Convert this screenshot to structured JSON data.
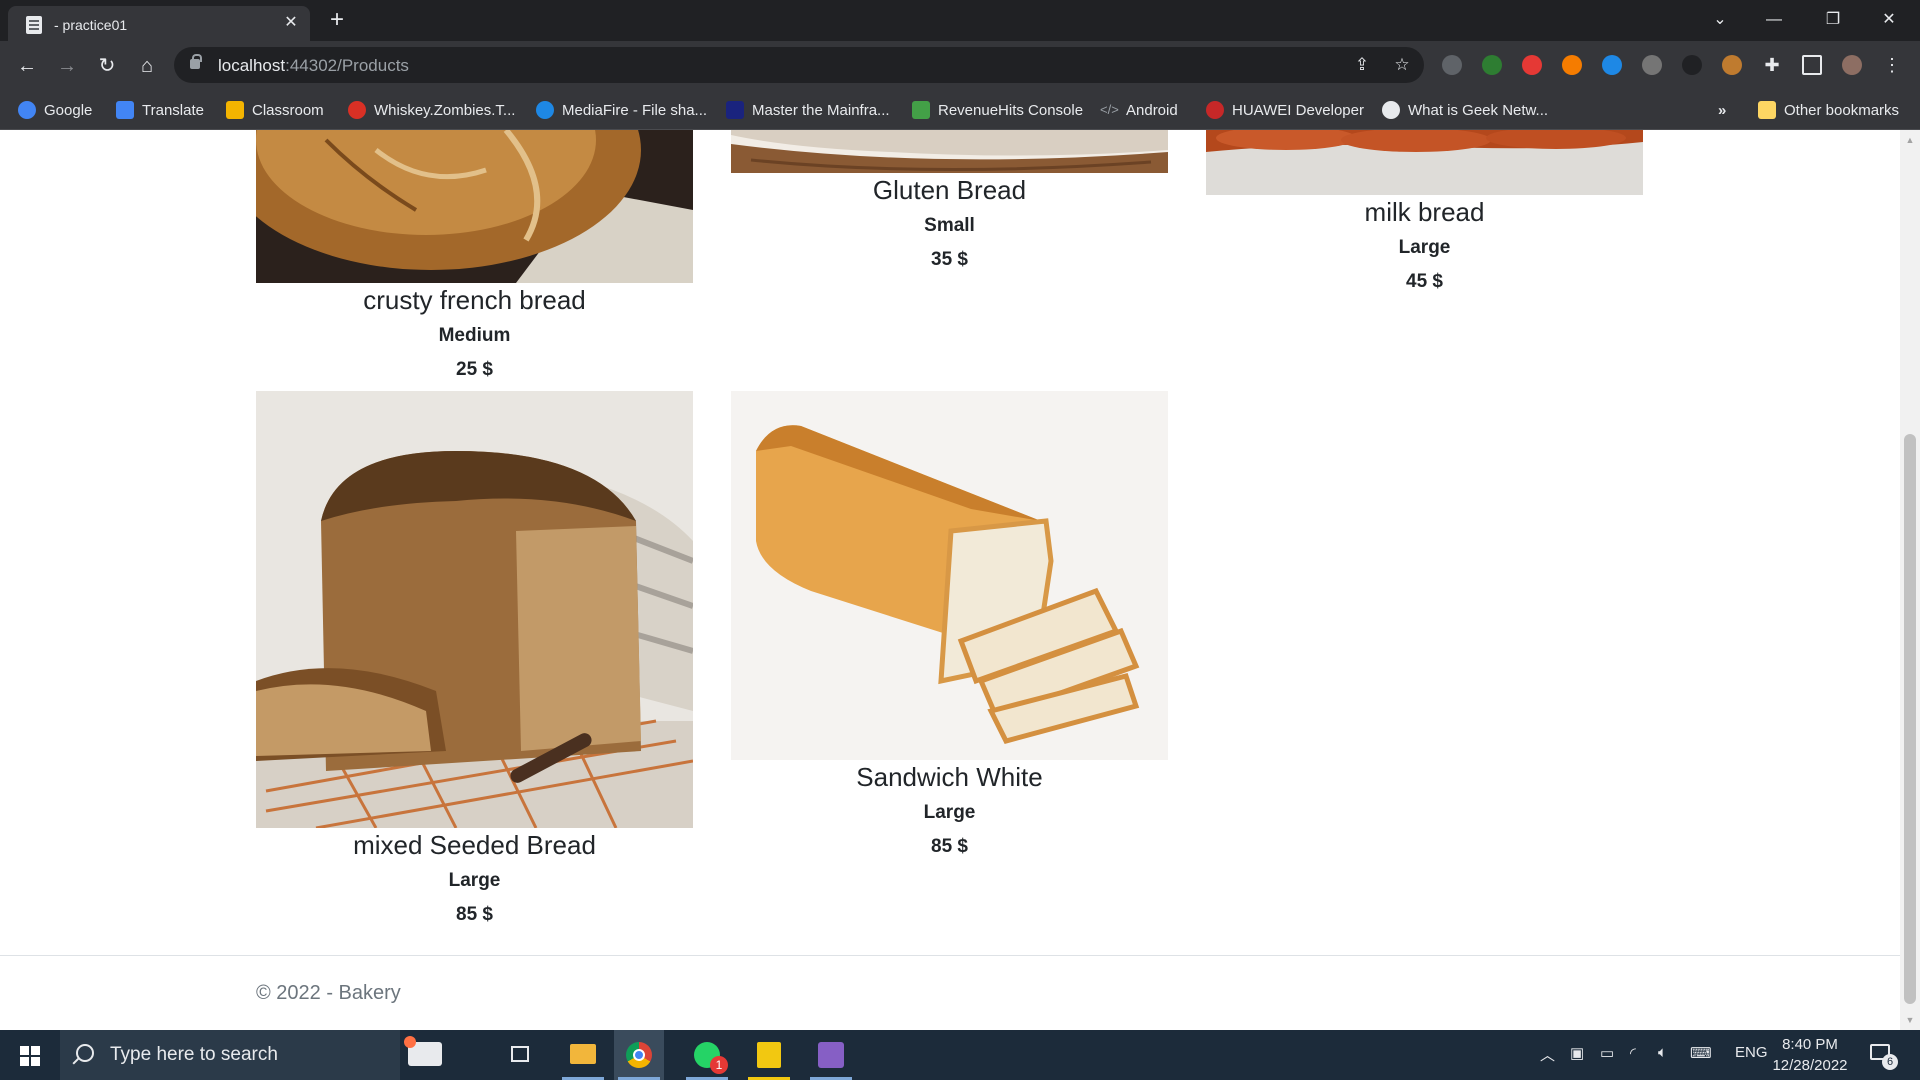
{
  "browser": {
    "tab_title": "- practice01",
    "url_host": "localhost",
    "url_path": ":44302/Products"
  },
  "bookmarks": [
    {
      "label": "Google",
      "icon": "google-icon",
      "color": "#4285f4"
    },
    {
      "label": "Translate",
      "icon": "translate-icon",
      "color": "#4285f4"
    },
    {
      "label": "Classroom",
      "icon": "classroom-icon",
      "color": "#f4b400"
    },
    {
      "label": "Whiskey.Zombies.T...",
      "icon": "whiskey-icon",
      "color": "#d93025"
    },
    {
      "label": "MediaFire - File sha...",
      "icon": "mediafire-icon",
      "color": "#1e88e5"
    },
    {
      "label": "Master the Mainfra...",
      "icon": "mainframe-icon",
      "color": "#1a237e"
    },
    {
      "label": "RevenueHits Console",
      "icon": "revenuehits-icon",
      "color": "#43a047"
    },
    {
      "label": "Android",
      "icon": "code-icon",
      "color": "#9aa0a6"
    },
    {
      "label": "HUAWEI Developer",
      "icon": "huawei-icon",
      "color": "#c62828"
    },
    {
      "label": "What is Geek Netw...",
      "icon": "globe-icon",
      "color": "#e8eaed"
    }
  ],
  "bookmarks_overflow": "»",
  "other_bookmarks": "Other bookmarks",
  "products": [
    {
      "name": "crusty french bread",
      "size": "Medium",
      "price": "25 $"
    },
    {
      "name": "Gluten Bread",
      "size": "Small",
      "price": "35 $"
    },
    {
      "name": "milk bread",
      "size": "Large",
      "price": "45 $"
    },
    {
      "name": "mixed Seeded Bread",
      "size": "Large",
      "price": "85 $"
    },
    {
      "name": "Sandwich White",
      "size": "Large",
      "price": "85 $"
    }
  ],
  "footer": {
    "text": "© 2022 - Bakery"
  },
  "taskbar": {
    "search_placeholder": "Type here to search",
    "whatsapp_badge": "1",
    "language": "ENG",
    "time": "8:40 PM",
    "date": "12/28/2022",
    "notification_count": "6"
  }
}
